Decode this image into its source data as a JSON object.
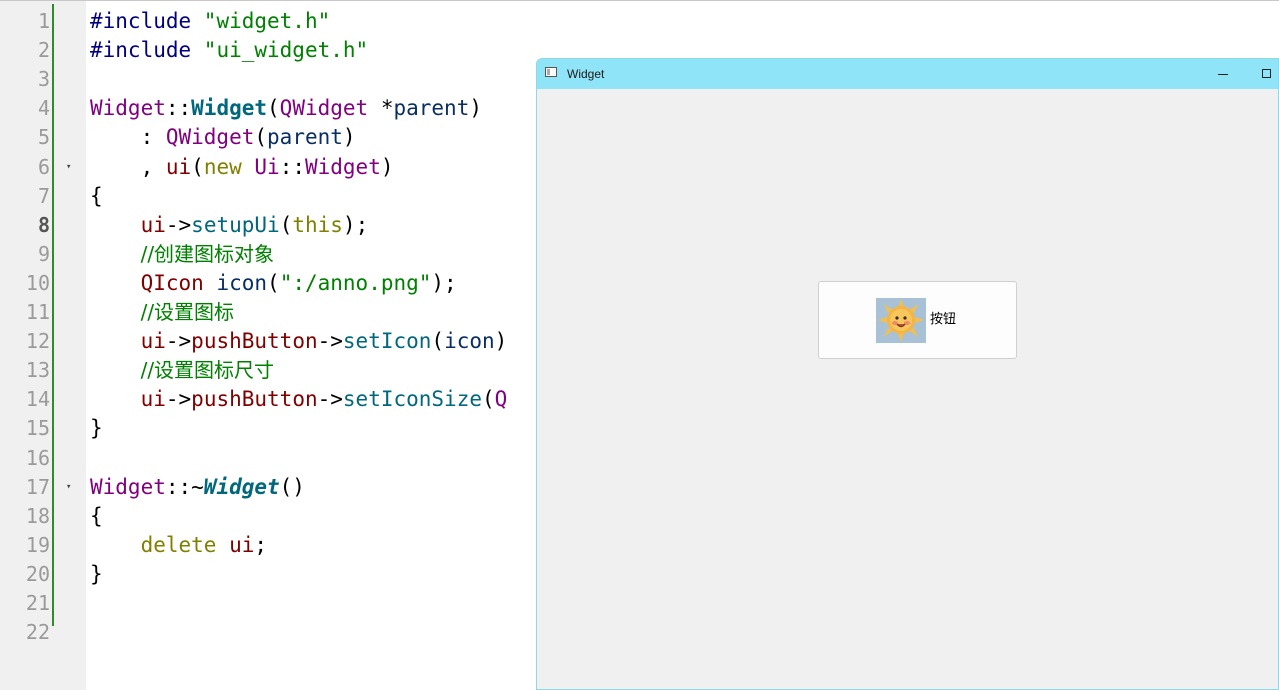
{
  "editor": {
    "lines": [
      {
        "no": "1",
        "tokens": [
          {
            "t": "#include ",
            "c": "macro"
          },
          {
            "t": "\"widget.h\"",
            "c": "str"
          }
        ]
      },
      {
        "no": "2",
        "tokens": [
          {
            "t": "#include ",
            "c": "macro"
          },
          {
            "t": "\"ui_widget.h\"",
            "c": "str"
          }
        ]
      },
      {
        "no": "3",
        "tokens": []
      },
      {
        "no": "4",
        "tokens": [
          {
            "t": "Widget",
            "c": "type"
          },
          {
            "t": "::",
            "c": ""
          },
          {
            "t": "Widget",
            "c": "ctor"
          },
          {
            "t": "(",
            "c": ""
          },
          {
            "t": "QWidget",
            "c": "type"
          },
          {
            "t": " *",
            "c": ""
          },
          {
            "t": "parent",
            "c": "var"
          },
          {
            "t": ")",
            "c": ""
          }
        ]
      },
      {
        "no": "5",
        "tokens": [
          {
            "t": "    : ",
            "c": ""
          },
          {
            "t": "QWidget",
            "c": "type"
          },
          {
            "t": "(",
            "c": ""
          },
          {
            "t": "parent",
            "c": "var"
          },
          {
            "t": ")",
            "c": ""
          }
        ]
      },
      {
        "no": "6",
        "fold": true,
        "tokens": [
          {
            "t": "    , ",
            "c": ""
          },
          {
            "t": "ui",
            "c": "member"
          },
          {
            "t": "(",
            "c": ""
          },
          {
            "t": "new ",
            "c": "kw"
          },
          {
            "t": "Ui",
            "c": "type"
          },
          {
            "t": "::",
            "c": ""
          },
          {
            "t": "Widget",
            "c": "type"
          },
          {
            "t": ")",
            "c": ""
          }
        ]
      },
      {
        "no": "7",
        "tokens": [
          {
            "t": "{",
            "c": ""
          }
        ]
      },
      {
        "no": "8",
        "current": true,
        "tokens": [
          {
            "t": "    ",
            "c": ""
          },
          {
            "t": "ui",
            "c": "member"
          },
          {
            "t": "->",
            "c": ""
          },
          {
            "t": "setupUi",
            "c": "func"
          },
          {
            "t": "(",
            "c": ""
          },
          {
            "t": "this",
            "c": "kw"
          },
          {
            "t": ");",
            "c": ""
          }
        ]
      },
      {
        "no": "9",
        "tokens": [
          {
            "t": "    ",
            "c": ""
          },
          {
            "t": "//创建图标对象",
            "c": "cmt"
          }
        ]
      },
      {
        "no": "10",
        "tokens": [
          {
            "t": "    ",
            "c": ""
          },
          {
            "t": "QIcon",
            "c": "member"
          },
          {
            "t": " ",
            "c": ""
          },
          {
            "t": "icon",
            "c": "var"
          },
          {
            "t": "(",
            "c": ""
          },
          {
            "t": "\":/anno.png\"",
            "c": "str"
          },
          {
            "t": ");",
            "c": ""
          }
        ]
      },
      {
        "no": "11",
        "tokens": [
          {
            "t": "    ",
            "c": ""
          },
          {
            "t": "//设置图标",
            "c": "cmt"
          }
        ]
      },
      {
        "no": "12",
        "tokens": [
          {
            "t": "    ",
            "c": ""
          },
          {
            "t": "ui",
            "c": "member"
          },
          {
            "t": "->",
            "c": ""
          },
          {
            "t": "pushButton",
            "c": "member"
          },
          {
            "t": "->",
            "c": ""
          },
          {
            "t": "setIcon",
            "c": "func"
          },
          {
            "t": "(",
            "c": ""
          },
          {
            "t": "icon",
            "c": "var"
          },
          {
            "t": ")",
            "c": ""
          }
        ]
      },
      {
        "no": "13",
        "tokens": [
          {
            "t": "    ",
            "c": ""
          },
          {
            "t": "//设置图标尺寸",
            "c": "cmt"
          }
        ]
      },
      {
        "no": "14",
        "tokens": [
          {
            "t": "    ",
            "c": ""
          },
          {
            "t": "ui",
            "c": "member"
          },
          {
            "t": "->",
            "c": ""
          },
          {
            "t": "pushButton",
            "c": "member"
          },
          {
            "t": "->",
            "c": ""
          },
          {
            "t": "setIconSize",
            "c": "func"
          },
          {
            "t": "(",
            "c": ""
          },
          {
            "t": "Q",
            "c": "type"
          }
        ]
      },
      {
        "no": "15",
        "tokens": [
          {
            "t": "}",
            "c": ""
          }
        ]
      },
      {
        "no": "16",
        "tokens": []
      },
      {
        "no": "17",
        "fold": true,
        "tokens": [
          {
            "t": "Widget",
            "c": "type"
          },
          {
            "t": "::~",
            "c": ""
          },
          {
            "t": "Widget",
            "c": "dtor"
          },
          {
            "t": "()",
            "c": ""
          }
        ]
      },
      {
        "no": "18",
        "tokens": [
          {
            "t": "{",
            "c": ""
          }
        ]
      },
      {
        "no": "19",
        "tokens": [
          {
            "t": "    ",
            "c": ""
          },
          {
            "t": "delete ",
            "c": "kw"
          },
          {
            "t": "ui",
            "c": "member"
          },
          {
            "t": ";",
            "c": ""
          }
        ]
      },
      {
        "no": "20",
        "tokens": [
          {
            "t": "}",
            "c": ""
          }
        ]
      },
      {
        "no": "21",
        "tokens": []
      },
      {
        "no": "22",
        "tokens": []
      }
    ]
  },
  "window": {
    "title": "Widget",
    "title_icon": "window-icon",
    "minimize_icon": "minimize-icon",
    "maximize_icon": "maximize-icon",
    "titlebar_color": "#8fe4f8",
    "button": {
      "label": "按钮",
      "icon": "sun-face-icon"
    }
  },
  "colors": {
    "accent_titlebar": "#8fe4f8",
    "change_bar": "#2e8b2e"
  }
}
